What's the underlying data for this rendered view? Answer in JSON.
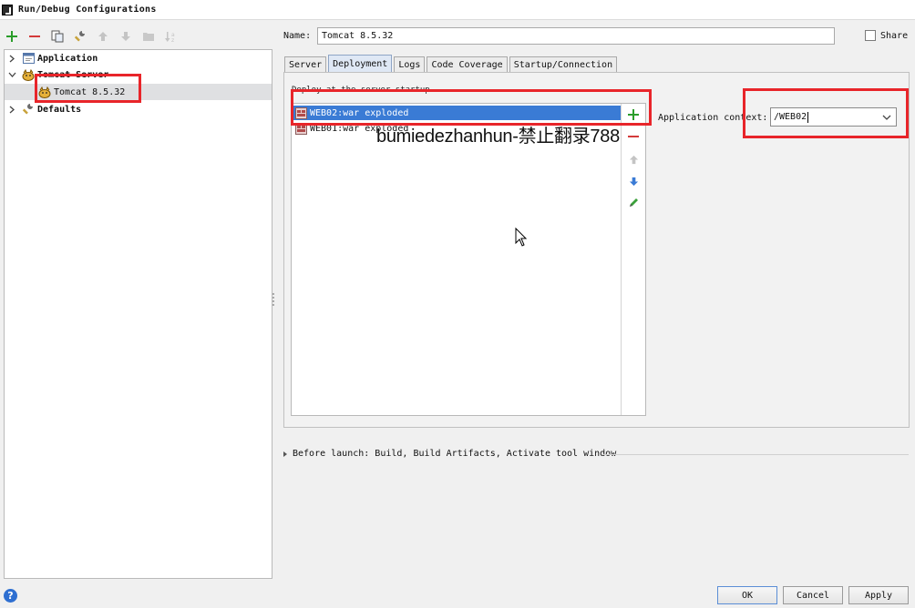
{
  "window": {
    "title": "Run/Debug Configurations"
  },
  "toolbar": {
    "add": "add-icon",
    "remove": "remove-icon",
    "copy": "copy-icon",
    "edit_defaults": "wrench-icon",
    "move_up": "arrow-up-icon",
    "move_down": "arrow-down-icon",
    "folder": "folder-icon",
    "sort": "sort-alpha-icon"
  },
  "tree": {
    "items": [
      {
        "label": "Application",
        "bold": true,
        "expanded": false
      },
      {
        "label": "Tomcat Server",
        "bold": true,
        "expanded": true
      },
      {
        "label": "Tomcat 8.5.32",
        "bold": false,
        "selected": true
      },
      {
        "label": "Defaults",
        "bold": true,
        "expanded": false
      }
    ]
  },
  "form": {
    "name_label": "Name:",
    "name_value": "Tomcat 8.5.32",
    "share_label": "Share",
    "share_checked": false
  },
  "tabs": [
    {
      "label": "Server",
      "active": false
    },
    {
      "label": "Deployment",
      "active": true
    },
    {
      "label": "Logs",
      "active": false
    },
    {
      "label": "Code Coverage",
      "active": false
    },
    {
      "label": "Startup/Connection",
      "active": false
    }
  ],
  "deployment": {
    "caption": "Deploy at the server startup",
    "artifacts": [
      {
        "label": "WEB02:war exploded",
        "selected": true
      },
      {
        "label": "WEB01:war exploded",
        "selected": false
      }
    ],
    "context_label": "Application context:",
    "context_value": "/WEB02"
  },
  "watermark": "bumiedezhanhun-禁止翻录788",
  "before_launch": "Before launch: Build, Build Artifacts, Activate tool window",
  "buttons": {
    "ok": "OK",
    "cancel": "Cancel",
    "apply": "Apply",
    "help": "?"
  },
  "colors": {
    "selection": "#3a7bd5",
    "annotation": "#e8252a",
    "add_green": "#2a9d2a",
    "remove_red": "#d43a3a"
  }
}
